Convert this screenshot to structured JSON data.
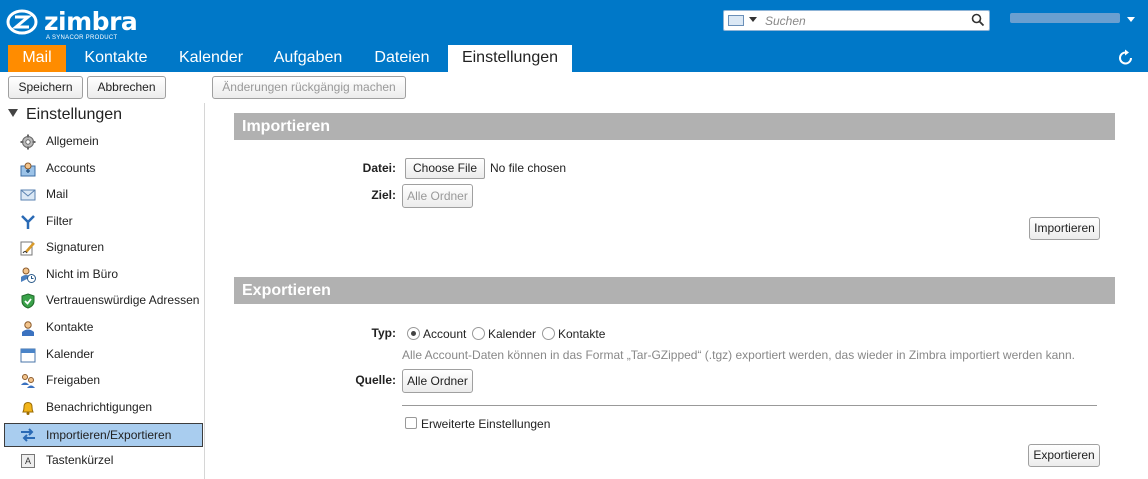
{
  "app": {
    "logo_text": "zimbra",
    "logo_sub": "A SYNACOR PRODUCT",
    "search_placeholder": "Suchen",
    "colors": {
      "topbar": "#0078c8",
      "mail_tab": "#ff8c00",
      "selected_nav": "#a9cdef",
      "section_header": "#b1b1b1"
    }
  },
  "tabs": [
    {
      "label": "Mail"
    },
    {
      "label": "Kontakte"
    },
    {
      "label": "Kalender"
    },
    {
      "label": "Aufgaben"
    },
    {
      "label": "Dateien"
    },
    {
      "label": "Einstellungen"
    }
  ],
  "toolbar": {
    "save": "Speichern",
    "cancel": "Abbrechen",
    "undo": "Änderungen rückgängig machen"
  },
  "sidebar": {
    "title": "Einstellungen",
    "items": [
      {
        "label": "Allgemein",
        "icon": "gear-icon"
      },
      {
        "label": "Accounts",
        "icon": "accounts-icon"
      },
      {
        "label": "Mail",
        "icon": "envelope-icon"
      },
      {
        "label": "Filter",
        "icon": "filter-icon"
      },
      {
        "label": "Signaturen",
        "icon": "signature-icon"
      },
      {
        "label": "Nicht im Büro",
        "icon": "out-of-office-icon"
      },
      {
        "label": "Vertrauenswürdige Adressen",
        "icon": "shield-icon"
      },
      {
        "label": "Kontakte",
        "icon": "contact-icon"
      },
      {
        "label": "Kalender",
        "icon": "calendar-icon"
      },
      {
        "label": "Freigaben",
        "icon": "sharing-icon"
      },
      {
        "label": "Benachrichtigungen",
        "icon": "bell-icon"
      },
      {
        "label": "Importieren/Exportieren",
        "icon": "import-export-icon"
      },
      {
        "label": "Tastenkürzel",
        "icon": "keyboard-icon"
      }
    ]
  },
  "import": {
    "title": "Importieren",
    "file_label": "Datei:",
    "choose_file": "Choose File",
    "no_file": "No file chosen",
    "target_label": "Ziel:",
    "target_value": "Alle Ordner",
    "button": "Importieren"
  },
  "export": {
    "title": "Exportieren",
    "type_label": "Typ:",
    "types": [
      "Account",
      "Kalender",
      "Kontakte"
    ],
    "selected_type": "Account",
    "hint": "Alle Account-Daten können in das Format „Tar-GZipped“ (.tgz) exportiert werden, das wieder in Zimbra importiert werden kann.",
    "source_label": "Quelle:",
    "source_value": "Alle Ordner",
    "advanced": "Erweiterte Einstellungen",
    "button": "Exportieren"
  }
}
